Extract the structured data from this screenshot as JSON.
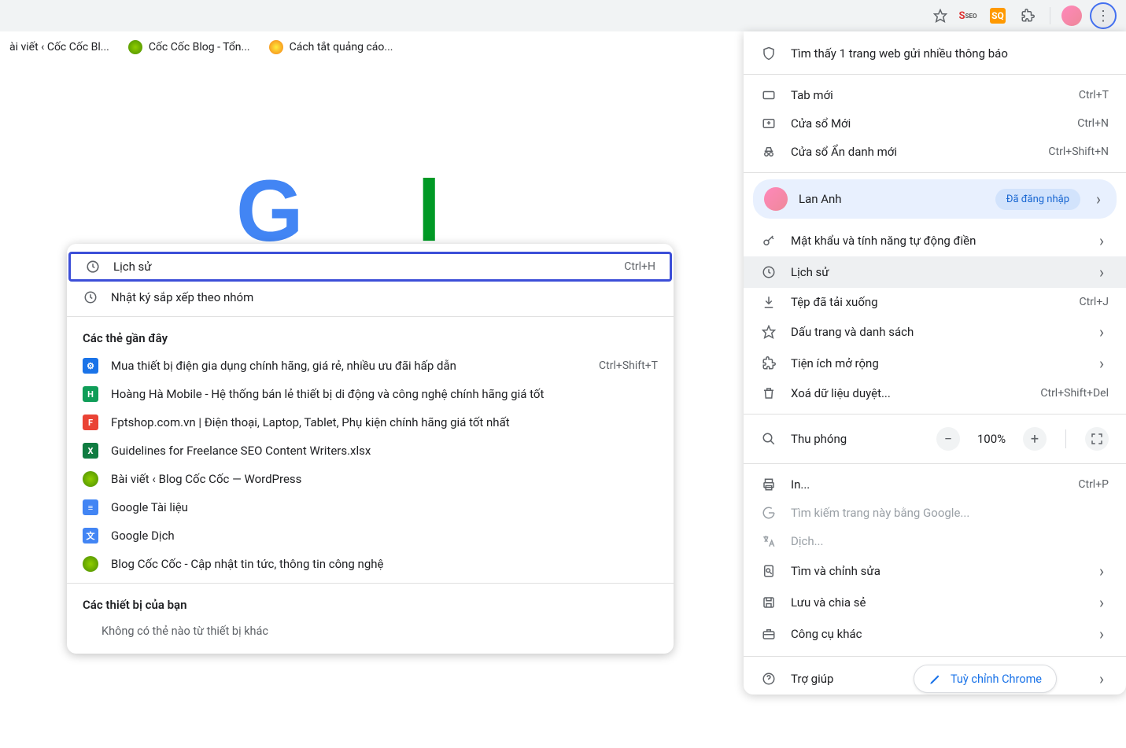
{
  "bookmarks": [
    {
      "label": "ài viết ‹ Cốc Cốc Bl...",
      "fav": "green"
    },
    {
      "label": "Cốc Cốc Blog - Tổn...",
      "fav": "green"
    },
    {
      "label": "Cách tắt quảng cáo...",
      "fav": "yellow"
    }
  ],
  "history_panel": {
    "top_items": [
      {
        "label": "Lịch sử",
        "shortcut": "Ctrl+H",
        "highlighted": true
      },
      {
        "label": "Nhật ký sắp xếp theo nhóm",
        "shortcut": "",
        "highlighted": false
      }
    ],
    "recent_title": "Các thẻ gần đây",
    "recent": [
      {
        "label": "Mua thiết bị điện gia dụng chính hãng, giá rẻ, nhiều ưu đãi hấp dẫn",
        "shortcut": "Ctrl+Shift+T",
        "fav": "blue"
      },
      {
        "label": "Hoàng Hà Mobile - Hệ thống bán lẻ thiết bị di động và công nghệ chính hãng giá tốt",
        "shortcut": "",
        "fav": "green"
      },
      {
        "label": "Fptshop.com.vn | Điện thoại, Laptop, Tablet, Phụ kiện chính hãng giá tốt nhất",
        "shortcut": "",
        "fav": "orange"
      },
      {
        "label": "Guidelines for Freelance SEO Content Writers.xlsx",
        "shortcut": "",
        "fav": "xlsx"
      },
      {
        "label": "Bài viết ‹ Blog Cốc Cốc — WordPress",
        "shortcut": "",
        "fav": "coc"
      },
      {
        "label": "Google Tài liệu",
        "shortcut": "",
        "fav": "docs"
      },
      {
        "label": "Google Dịch",
        "shortcut": "",
        "fav": "trans"
      },
      {
        "label": "Blog Cốc Cốc - Cập nhật tin tức, thông tin công nghệ",
        "shortcut": "",
        "fav": "coc"
      }
    ],
    "devices_title": "Các thiết bị của bạn",
    "devices_empty": "Không có thẻ nào từ thiết bị khác"
  },
  "chrome_menu": {
    "notice": "Tìm thấy 1 trang web gửi nhiều thông báo",
    "new_tab": {
      "label": "Tab mới",
      "shortcut": "Ctrl+T"
    },
    "new_window": {
      "label": "Cửa sổ Mới",
      "shortcut": "Ctrl+N"
    },
    "incognito": {
      "label": "Cửa sổ Ẩn danh mới",
      "shortcut": "Ctrl+Shift+N"
    },
    "user": {
      "name": "Lan Anh",
      "badge": "Đã đăng nhập"
    },
    "passwords": {
      "label": "Mật khẩu và tính năng tự động điền"
    },
    "history": {
      "label": "Lịch sử"
    },
    "downloads": {
      "label": "Tệp đã tải xuống",
      "shortcut": "Ctrl+J"
    },
    "bookmarks": {
      "label": "Dấu trang và danh sách"
    },
    "extensions": {
      "label": "Tiện ích mở rộng"
    },
    "clear": {
      "label": "Xoá dữ liệu duyệt...",
      "shortcut": "Ctrl+Shift+Del"
    },
    "zoom": {
      "label": "Thu phóng",
      "value": "100%"
    },
    "print": {
      "label": "In...",
      "shortcut": "Ctrl+P"
    },
    "gsearch": {
      "label": "Tìm kiếm trang này bằng Google..."
    },
    "translate": {
      "label": "Dịch..."
    },
    "find": {
      "label": "Tìm và chỉnh sửa"
    },
    "save_share": {
      "label": "Lưu và chia sẻ"
    },
    "more_tools": {
      "label": "Công cụ khác"
    },
    "help": {
      "label": "Trợ giúp"
    }
  },
  "customize": "Tuỳ chỉnh Chrome"
}
